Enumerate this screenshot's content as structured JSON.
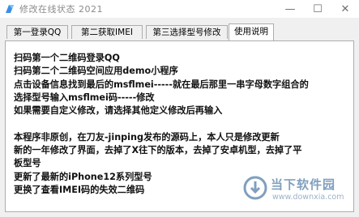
{
  "window": {
    "title": "修改在线状态     2021",
    "controls": {
      "minimize": "—",
      "maximize": "☐",
      "close": "✕"
    }
  },
  "tabs": [
    {
      "label": "第一登录QQ",
      "active": false
    },
    {
      "label": "第二获取IMEI",
      "active": false
    },
    {
      "label": "第三选择型号修改",
      "active": false
    },
    {
      "label": "使用说明",
      "active": true
    }
  ],
  "instructions": [
    "扫码第一个二维码登录QQ",
    "扫码第二个二维码空间应用demo小程序",
    "点击设备信息找到最后的msflmei-----就在最后那里一串字母数字组合的",
    "选择型号输入msflmei码-----修改",
    "如果需要自定义修改，请选择其他定义修改后再输入",
    "",
    "本程序非原创，在刀友-jinping发布的源码上，本人只是修改更新",
    "新的一年修改了界面，去掉了X往下的版本，去掉了安卓机型，去掉了平",
    "板型号",
    "更新了最新的iPhone12系列型号",
    "更换了查看IMEI码的失效二维码"
  ],
  "watermark": {
    "name": "当下软件园",
    "url": "www.downxia.com"
  },
  "colors": {
    "title_text": "#8a8a8a",
    "client_bg": "#f0f0f0",
    "panel_bg": "#ffffff",
    "tab_border": "#adadad",
    "watermark": "#6b8fb3"
  }
}
